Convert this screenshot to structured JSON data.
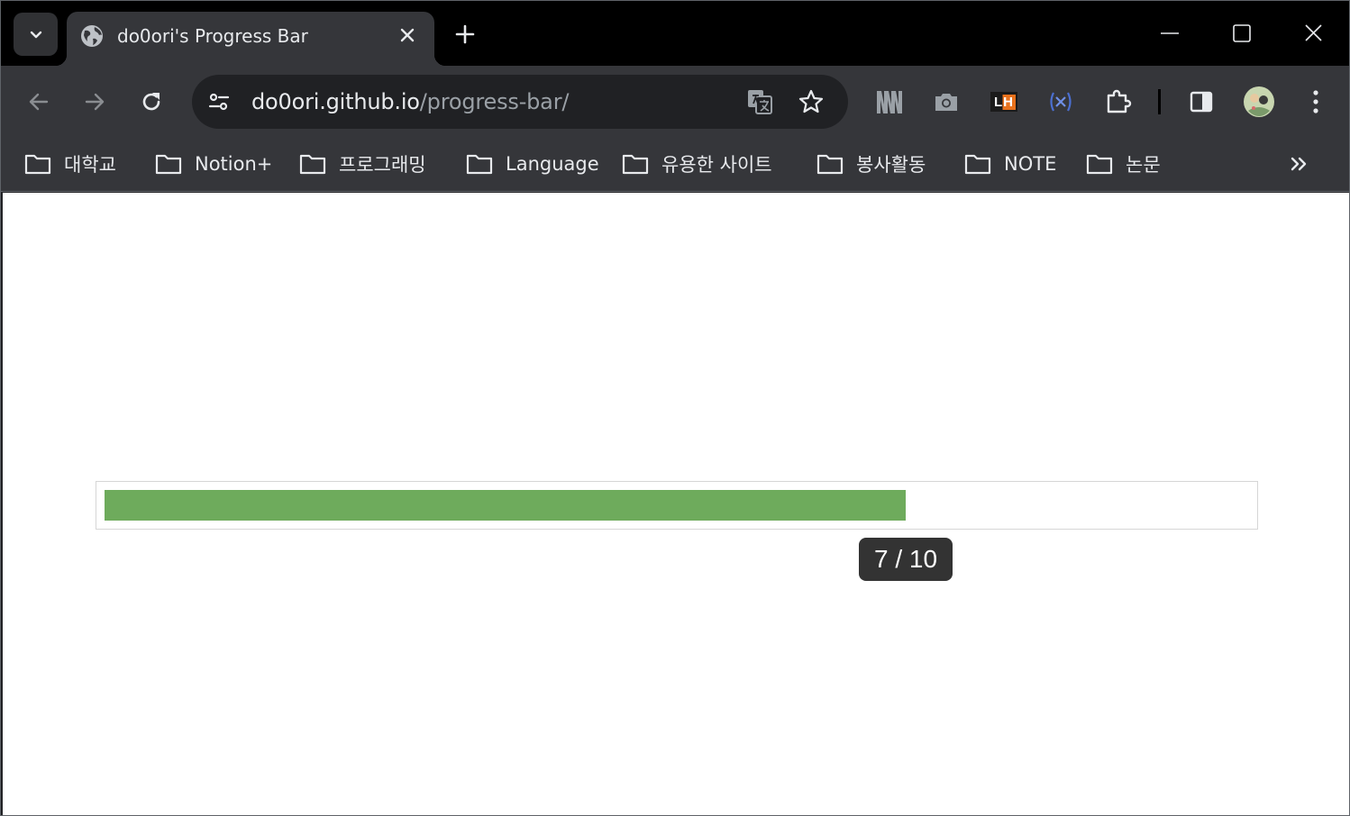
{
  "tab": {
    "title": "do0ori's Progress Bar"
  },
  "omnibox": {
    "host": "do0ori.github.io",
    "path": "/progress-bar/"
  },
  "extensions": {
    "lighthouse_label": "LH"
  },
  "bookmarks": [
    {
      "label": "대학교"
    },
    {
      "label": "Notion+"
    },
    {
      "label": "프로그래밍"
    },
    {
      "label": "Language"
    },
    {
      "label": "유용한 사이트"
    },
    {
      "label": "봉사활동"
    },
    {
      "label": "NOTE"
    },
    {
      "label": "논문"
    }
  ],
  "progress": {
    "current": 7,
    "total": 10,
    "label": "7 / 10",
    "fill_color": "#6eab5c",
    "tooltip_color": "#333333"
  },
  "colors": {
    "tabstrip": "#000000",
    "toolbar": "#35363a",
    "omnibox": "#202124",
    "text": "#e8eaed",
    "muted_text": "#9aa0a6"
  }
}
